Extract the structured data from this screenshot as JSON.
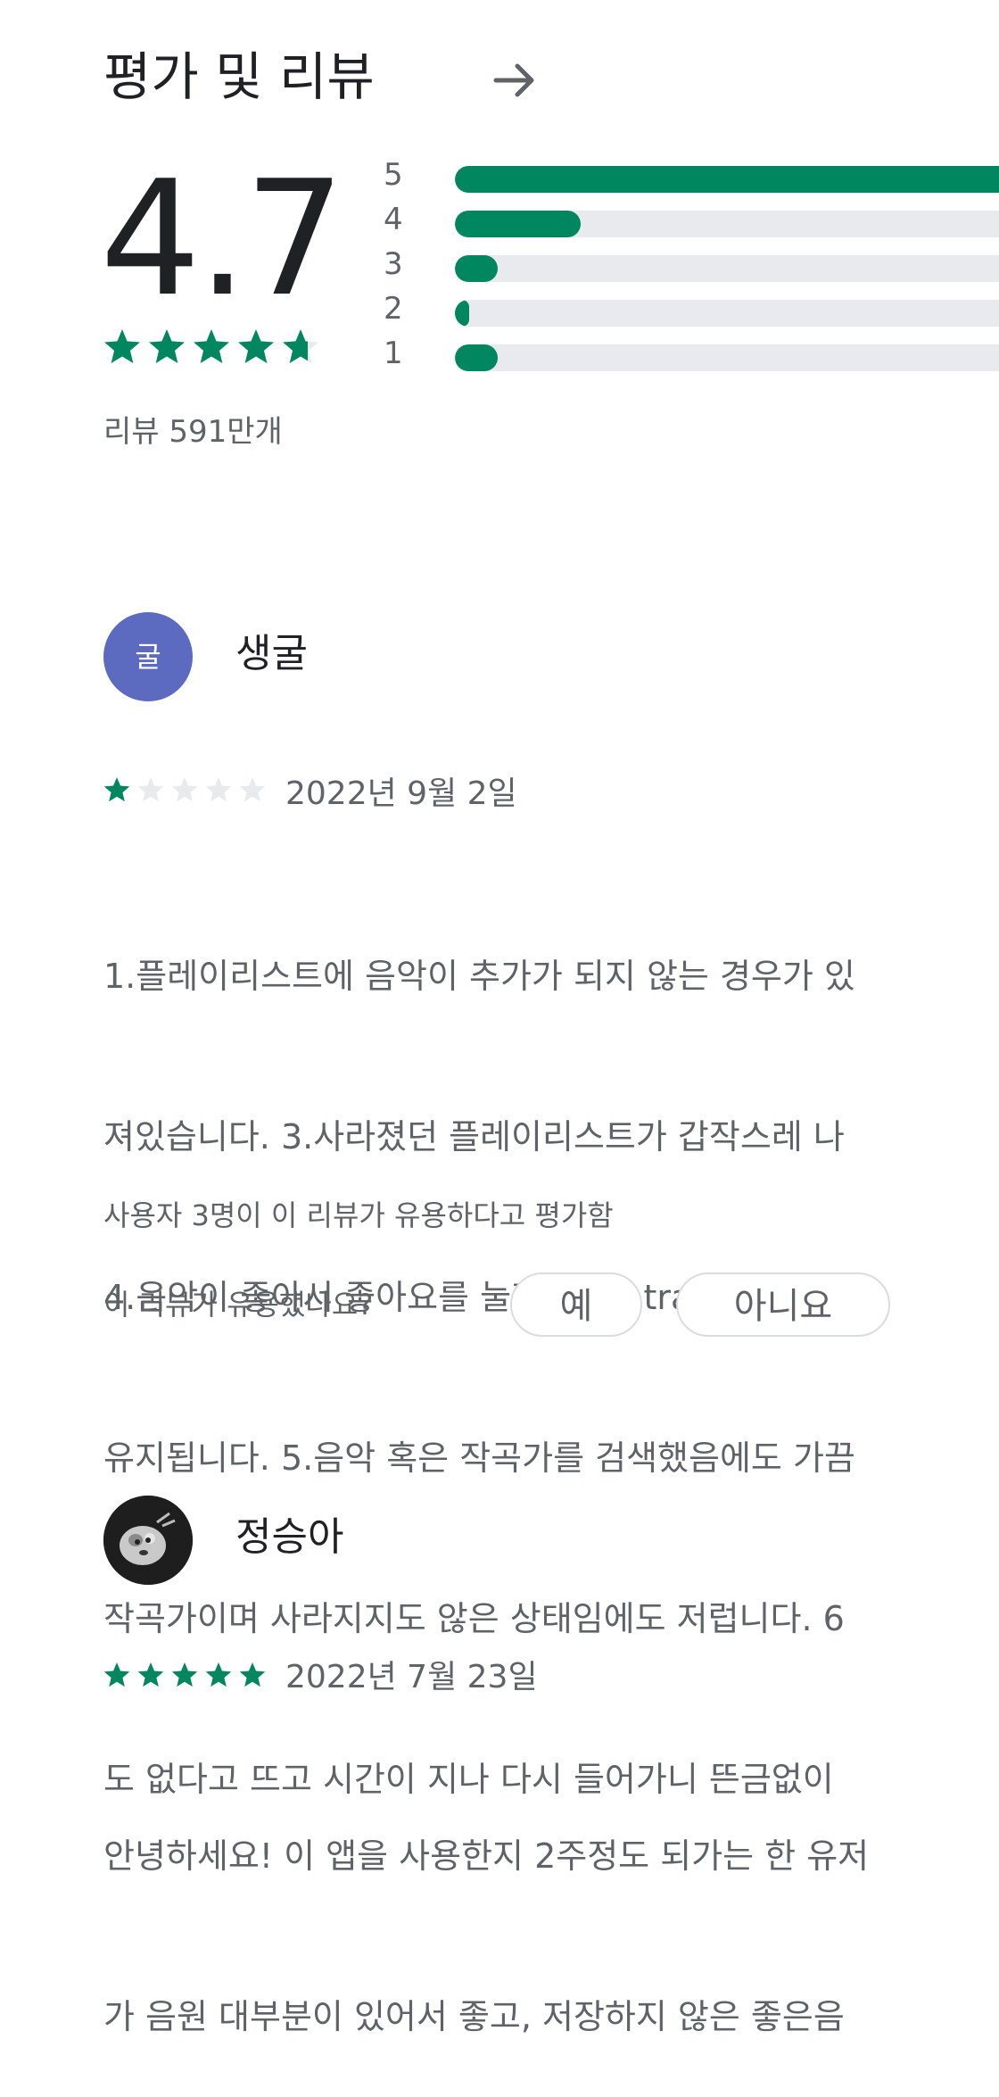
{
  "header": {
    "title": "평가 및 리뷰",
    "arrow_icon": "arrow-right-icon"
  },
  "summary": {
    "score": "4.7",
    "stars": 4.7,
    "review_count": "리뷰 591만개",
    "bars": [
      {
        "label": "5",
        "fraction": 1.0
      },
      {
        "label": "4",
        "fraction": 0.22
      },
      {
        "label": "3",
        "fraction": 0.075
      },
      {
        "label": "2",
        "fraction": 0.015
      },
      {
        "label": "1",
        "fraction": 0.075
      }
    ]
  },
  "colors": {
    "accent": "#01875f",
    "track": "#e8eaed",
    "empty_star": "#e8eaed",
    "avatar": "#5c6bc0"
  },
  "reviews": [
    {
      "avatar_letter": "굴",
      "name": "생굴",
      "stars": 1,
      "date": "2022년 9월 2일",
      "text_lines": [
        "1.플레이리스트에 음악이 추가가 되지 않는 경우가 있",
        "져있습니다. 3.사라졌던 플레이리스트가 갑작스레 나",
        "4.음악이 좋아서 좋아요를 눌러 liked track에 추가했",
        "유지됩니다. 5.음악 혹은 작곡가를 검색했음에도 가끔",
        "작곡가이며 사라지지도 않은 상태임에도 저럽니다. 6",
        "도 없다고 뜨고 시간이 지나 다시 들어가니 뜬금없이"
      ],
      "helpful_count": "사용자 3명이 이 리뷰가 유용하다고 평가함",
      "helpful_question": "이 리뷰가 유용했나요?",
      "yes_label": "예",
      "no_label": "아니요"
    },
    {
      "name": "정승아",
      "stars": 5,
      "date": "2022년 7월 23일",
      "text_lines": [
        "안녕하세요! 이 앱을 사용한지 2주정도 되가는 한 유저",
        "가 음원 대부분이 있어서 좋고, 저장하지 않은 좋은음"
      ]
    }
  ]
}
